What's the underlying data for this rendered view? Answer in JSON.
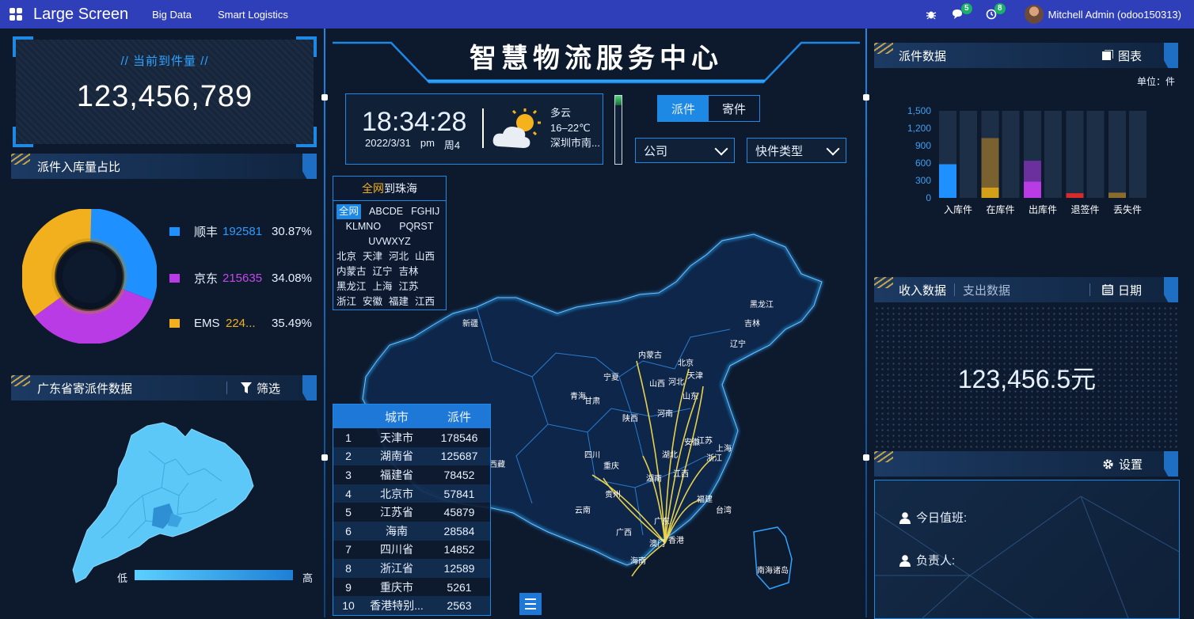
{
  "topbar": {
    "brand": "Large Screen",
    "nav": [
      "Big Data",
      "Smart Logistics"
    ],
    "messages_count": "5",
    "activities_count": "8",
    "user": "Mitchell Admin (odoo150313)"
  },
  "left": {
    "counter_title": "// 当前到件量 //",
    "counter_value": "123,456,789",
    "pie_title": "派件入库量占比",
    "pie_legend": [
      {
        "name": "顺丰",
        "value": "192581",
        "pct": "30.87%",
        "color": "#1e90ff"
      },
      {
        "name": "京东",
        "value": "215635",
        "pct": "34.08%",
        "color": "#b83be6"
      },
      {
        "name": "EMS",
        "value": "224...",
        "pct": "35.49%",
        "color": "#f2b01e"
      }
    ],
    "gd_title": "广东省寄派件数据",
    "gd_filter": "筛选",
    "scale_low": "低",
    "scale_high": "高"
  },
  "mid": {
    "title": "智慧物流服务中心",
    "time": "18:34:28",
    "date": "2022/3/31",
    "ampm": "pm",
    "weekday": "周4",
    "weather": "多云",
    "temp": "16–22℃",
    "location": "深圳市南...",
    "seg_buttons": [
      "派件",
      "寄件"
    ],
    "select_company": "公司",
    "select_type": "快件类型",
    "filter_title_a": "全网",
    "filter_title_b": "到珠海",
    "filter_tabs": [
      "全网",
      "ABCDE",
      "FGHIJ",
      "KLMNO",
      "PQRST",
      "UVWXYZ"
    ],
    "filter_provinces": [
      "北京",
      "天津",
      "河北",
      "山西",
      "内蒙古",
      "辽宁",
      "吉林",
      "黑龙江",
      "上海",
      "江苏",
      "浙江",
      "安徽",
      "福建",
      "江西"
    ],
    "table_headers": [
      "城市",
      "派件"
    ],
    "table_rows": [
      [
        "1",
        "天津市",
        "178546"
      ],
      [
        "2",
        "湖南省",
        "125687"
      ],
      [
        "3",
        "福建省",
        "78452"
      ],
      [
        "4",
        "北京市",
        "57841"
      ],
      [
        "5",
        "江苏省",
        "45879"
      ],
      [
        "6",
        "海南",
        "28584"
      ],
      [
        "7",
        "四川省",
        "14852"
      ],
      [
        "8",
        "浙江省",
        "12589"
      ],
      [
        "9",
        "重庆市",
        "5261"
      ],
      [
        "10",
        "香港特别...",
        "2563"
      ]
    ],
    "map_labels": [
      {
        "name": "黑龙江"
      },
      {
        "name": "吉林"
      },
      {
        "name": "辽宁"
      },
      {
        "name": "新疆"
      },
      {
        "name": "内蒙古"
      },
      {
        "name": "北京"
      },
      {
        "name": "天津"
      },
      {
        "name": "河北"
      },
      {
        "name": "山西"
      },
      {
        "name": "宁夏"
      },
      {
        "name": "山东"
      },
      {
        "name": "青海"
      },
      {
        "name": "甘肃"
      },
      {
        "name": "陕西"
      },
      {
        "name": "河南"
      },
      {
        "name": "安徽"
      },
      {
        "name": "江苏"
      },
      {
        "name": "上海"
      },
      {
        "name": "西藏"
      },
      {
        "name": "四川"
      },
      {
        "name": "湖北"
      },
      {
        "name": "浙江"
      },
      {
        "name": "重庆"
      },
      {
        "name": "湖南"
      },
      {
        "name": "江西"
      },
      {
        "name": "贵州"
      },
      {
        "name": "福建"
      },
      {
        "name": "云南"
      },
      {
        "name": "台湾"
      },
      {
        "name": "广西"
      },
      {
        "name": "广东"
      },
      {
        "name": "澳门"
      },
      {
        "name": "香港"
      },
      {
        "name": "海南"
      },
      {
        "name": "南海诸岛"
      }
    ]
  },
  "right": {
    "dispatch_title": "派件数据",
    "chart_button": "图表",
    "unit": "单位：件",
    "income_tab": "收入数据",
    "expense_tab": "支出数据",
    "date_button": "日期",
    "money_value": "123,456.5元",
    "settings": "设置",
    "duty_label": "今日值班:",
    "owner_label": "负责人:"
  },
  "chart_data": {
    "type": "bar",
    "categories": [
      "入库件",
      "在库件",
      "出库件",
      "退签件",
      "丢失件"
    ],
    "series": [
      {
        "values": [
          580,
          180,
          280,
          80,
          90
        ]
      },
      {
        "values": [
          0,
          850,
          360,
          0,
          0
        ]
      }
    ],
    "colors": [
      "#1e90ff",
      "#d4a017",
      "#b83be6",
      "#d62b2b",
      "#8a6d2c"
    ],
    "yticks": [
      "1,500",
      "1,200",
      "900",
      "600",
      "300",
      "0"
    ],
    "ylim": [
      0,
      1500
    ]
  }
}
